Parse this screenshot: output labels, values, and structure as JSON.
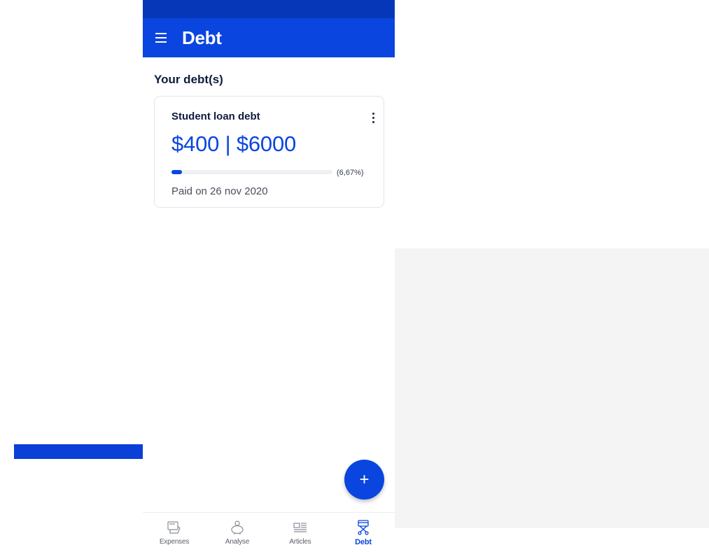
{
  "header": {
    "title": "Debt"
  },
  "section": {
    "title": "Your debt(s)"
  },
  "debt_card": {
    "name": "Student loan debt",
    "amounts": "$400 | $6000",
    "progress_percent": 6.67,
    "percent_label": "(6,67%)",
    "paid_on": "Paid on 26 nov 2020"
  },
  "fab": {
    "label": "+"
  },
  "bottom_nav": {
    "items": [
      {
        "label": "Expenses",
        "icon": "wallet-icon"
      },
      {
        "label": "Analyse",
        "icon": "piggy-bank-icon"
      },
      {
        "label": "Articles",
        "icon": "articles-icon"
      },
      {
        "label": "Debt",
        "icon": "debt-icon",
        "active": true
      }
    ]
  },
  "colors": {
    "accent": "#0a45e0",
    "status_bar": "#0537b8",
    "text_dark": "#0f1c3d"
  }
}
